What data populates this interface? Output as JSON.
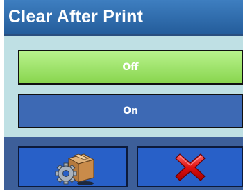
{
  "dialog": {
    "title": "Clear After Print",
    "options": [
      {
        "label": "Off",
        "selected": true,
        "color": "#9ee36a"
      },
      {
        "label": "On",
        "selected": false,
        "color": "#3d69b4"
      }
    ]
  },
  "footer": {
    "buttons": [
      {
        "name": "setup",
        "icon": "box-gear-icon"
      },
      {
        "name": "cancel",
        "icon": "red-x-icon"
      }
    ]
  },
  "colors": {
    "title_bar": "#2f6db0",
    "background": "#bfe0e4",
    "footer": "#3d5f99",
    "footer_button": "#2860c8"
  }
}
